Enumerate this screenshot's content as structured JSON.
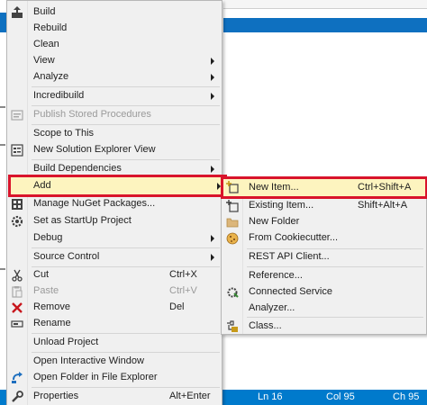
{
  "context_menu": {
    "items": [
      {
        "label": "Build"
      },
      {
        "label": "Rebuild"
      },
      {
        "label": "Clean"
      },
      {
        "label": "View"
      },
      {
        "label": "Analyze"
      },
      {
        "label": "Incredibuild"
      },
      {
        "label": "Publish Stored Procedures"
      },
      {
        "label": "Scope to This"
      },
      {
        "label": "New Solution Explorer View"
      },
      {
        "label": "Build Dependencies"
      },
      {
        "label": "Add"
      },
      {
        "label": "Manage NuGet Packages..."
      },
      {
        "label": "Set as StartUp Project"
      },
      {
        "label": "Debug"
      },
      {
        "label": "Source Control"
      },
      {
        "label": "Cut",
        "shortcut": "Ctrl+X"
      },
      {
        "label": "Paste",
        "shortcut": "Ctrl+V"
      },
      {
        "label": "Remove",
        "shortcut": "Del"
      },
      {
        "label": "Rename"
      },
      {
        "label": "Unload Project"
      },
      {
        "label": "Open Interactive Window"
      },
      {
        "label": "Open Folder in File Explorer"
      },
      {
        "label": "Properties",
        "shortcut": "Alt+Enter"
      }
    ]
  },
  "add_submenu": {
    "items": [
      {
        "label": "New Item...",
        "shortcut": "Ctrl+Shift+A"
      },
      {
        "label": "Existing Item...",
        "shortcut": "Shift+Alt+A"
      },
      {
        "label": "New Folder"
      },
      {
        "label": "From Cookiecutter..."
      },
      {
        "label": "REST API Client..."
      },
      {
        "label": "Reference..."
      },
      {
        "label": "Connected Service"
      },
      {
        "label": "Analyzer..."
      },
      {
        "label": "Class..."
      }
    ]
  },
  "status_bar": {
    "line": "Ln 16",
    "col": "Col 95",
    "ch": "Ch 95"
  },
  "colors": {
    "accent_blue": "#007acc",
    "highlight_red": "#d9142b",
    "hover_yellow": "#fdf4bf"
  }
}
